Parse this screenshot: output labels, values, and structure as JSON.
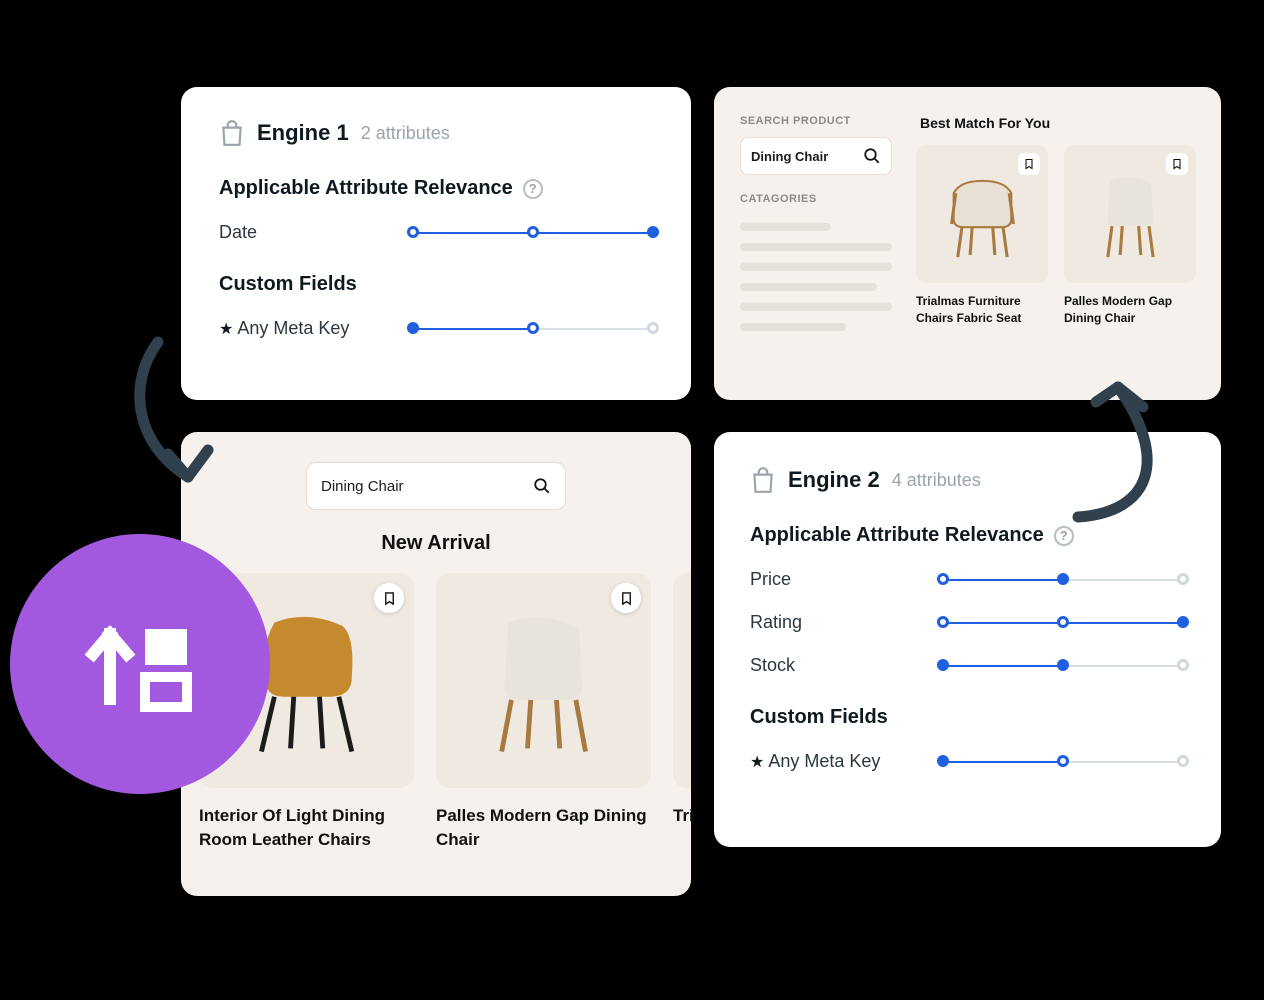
{
  "engine1": {
    "title": "Engine 1",
    "sub": "2 attributes",
    "section": "Applicable Attribute Relevance",
    "rows": [
      {
        "label": "Date",
        "fill": 100,
        "dots": [
          0,
          50,
          100
        ],
        "active": [
          true,
          true,
          true
        ]
      }
    ],
    "custom_title": "Custom Fields",
    "custom_rows": [
      {
        "label": "Any Meta Key",
        "fill": 50,
        "dots": [
          0,
          50,
          100
        ],
        "active": [
          true,
          true,
          false
        ]
      }
    ]
  },
  "engine2": {
    "title": "Engine 2",
    "sub": "4 attributes",
    "section": "Applicable Attribute Relevance",
    "rows": [
      {
        "label": "Price",
        "fill": 50,
        "dots": [
          0,
          50,
          100
        ],
        "active": [
          true,
          true,
          false
        ]
      },
      {
        "label": "Rating",
        "fill": 100,
        "dots": [
          0,
          50,
          100
        ],
        "active": [
          true,
          true,
          true
        ]
      },
      {
        "label": "Stock",
        "fill": 50,
        "dots": [
          0,
          50,
          100
        ],
        "active": [
          true,
          true,
          false
        ]
      }
    ],
    "custom_title": "Custom Fields",
    "custom_rows": [
      {
        "label": "Any Meta Key",
        "fill": 50,
        "dots": [
          0,
          50,
          100
        ],
        "active": [
          true,
          true,
          false
        ]
      }
    ]
  },
  "newarr": {
    "search": "Dining Chair",
    "heading": "New Arrival",
    "products": [
      {
        "name": "Interior Of Light Dining Room Leather Chairs",
        "color": "#c58a2e"
      },
      {
        "name": "Palles Modern Gap Dining Chair",
        "color": "#d9d3cb"
      },
      {
        "name": "Tria Mot",
        "color": "#c9a06e"
      }
    ]
  },
  "bestmatch": {
    "search_label": "SEARCH PRODUCT",
    "search": "Dining Chair",
    "cat_label": "CATAGORIES",
    "heading": "Best Match For You",
    "cards": [
      {
        "name": "Trialmas Furniture Chairs Fabric Seat",
        "color": "#c9a06e"
      },
      {
        "name": "Palles Modern Gap Dining Chair",
        "color": "#d9d3cb"
      }
    ]
  }
}
